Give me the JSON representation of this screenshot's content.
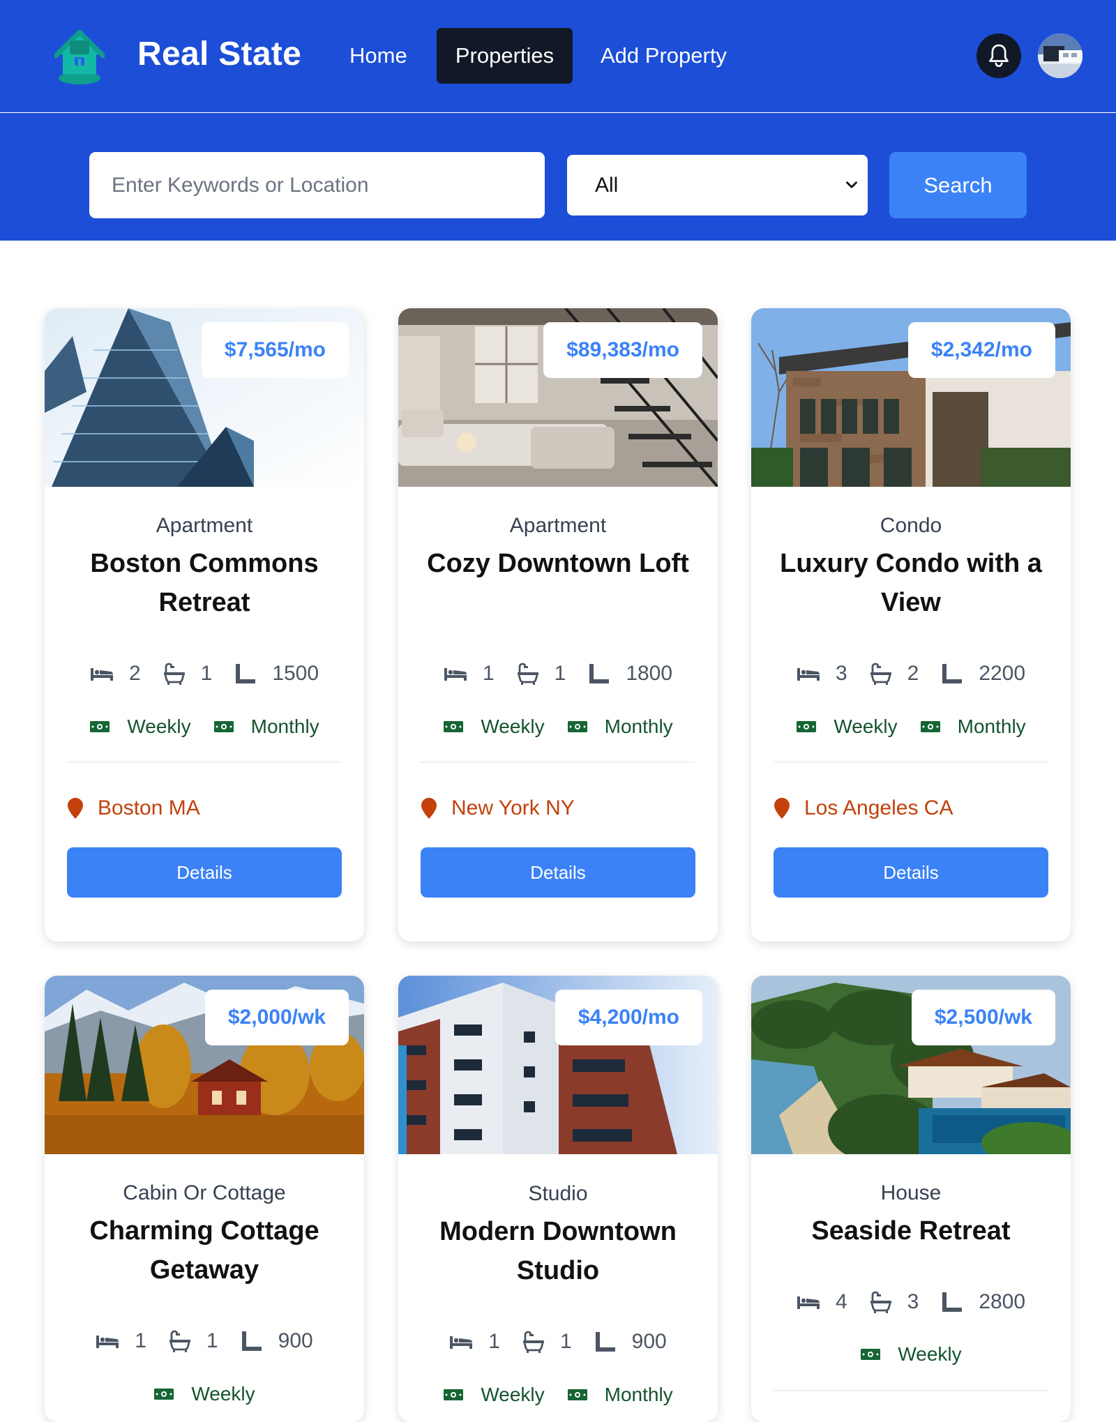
{
  "nav": {
    "brand": "Real State",
    "links": [
      "Home",
      "Properties",
      "Add Property"
    ],
    "active_link": "Properties",
    "notification_icon": "bell-icon",
    "avatar_icon": "user-avatar"
  },
  "search": {
    "placeholder": "Enter Keywords or Location",
    "type_value": "All",
    "button_label": "Search"
  },
  "colors": {
    "primary": "#1d4ed8",
    "accent": "#3b82f6",
    "active_nav": "#111827",
    "location": "#c2410c",
    "rate": "#14532d"
  },
  "properties": [
    {
      "price": "$7,565/mo",
      "type": "Apartment",
      "name": "Boston Commons Retreat",
      "beds": "2",
      "baths": "1",
      "sqft": "1500",
      "rates": [
        "Weekly",
        "Monthly"
      ],
      "location": "Boston MA",
      "button": "Details"
    },
    {
      "price": "$89,383/mo",
      "type": "Apartment",
      "name": "Cozy Downtown Loft",
      "beds": "1",
      "baths": "1",
      "sqft": "1800",
      "rates": [
        "Weekly",
        "Monthly"
      ],
      "location": "New York NY",
      "button": "Details"
    },
    {
      "price": "$2,342/mo",
      "type": "Condo",
      "name": "Luxury Condo with a View",
      "beds": "3",
      "baths": "2",
      "sqft": "2200",
      "rates": [
        "Weekly",
        "Monthly"
      ],
      "location": "Los Angeles CA",
      "button": "Details"
    },
    {
      "price": "$2,000/wk",
      "type": "Cabin Or Cottage",
      "name": "Charming Cottage Getaway",
      "beds": "1",
      "baths": "1",
      "sqft": "900",
      "rates": [
        "Weekly"
      ]
    },
    {
      "price": "$4,200/mo",
      "type": "Studio",
      "name": "Modern Downtown Studio",
      "beds": "1",
      "baths": "1",
      "sqft": "900",
      "rates": [
        "Weekly",
        "Monthly"
      ]
    },
    {
      "price": "$2,500/wk",
      "type": "House",
      "name": "Seaside Retreat",
      "beds": "4",
      "baths": "3",
      "sqft": "2800",
      "rates": [
        "Weekly"
      ]
    }
  ]
}
